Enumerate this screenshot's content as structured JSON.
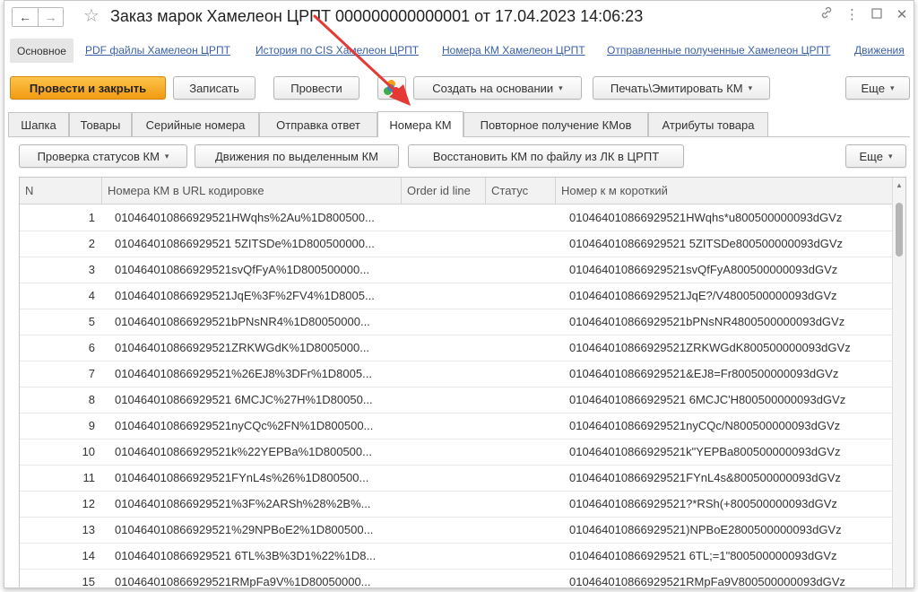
{
  "window": {
    "title": "Заказ марок Хамелеон ЦРПТ 000000000000001 от 17.04.2023 14:06:23",
    "nav_back": "←",
    "nav_forward": "→",
    "star": "☆",
    "icons": [
      "link-icon",
      "more-icon",
      "maximize-icon",
      "close-icon"
    ]
  },
  "links": {
    "main": "Основное",
    "items": [
      "PDF файлы  Хамелеон ЦРПТ",
      "История по CIS Хамелеон ЦРПТ",
      "Номера КМ Хамелеон ЦРПТ",
      "Отправленные полученные Хамелеон ЦРПТ",
      "Движения"
    ]
  },
  "commands": {
    "post_close": "Провести и закрыть",
    "save": "Записать",
    "post": "Провести",
    "create_based": "Создать на основании",
    "print": "Печать\\Эмитировать КМ",
    "more": "Еще"
  },
  "tabs": [
    "Шапка",
    "Товары",
    "Серийные номера",
    "Отправка ответ",
    "Номера КМ",
    "Повторное получение КМов",
    "Атрибуты товара"
  ],
  "active_tab": "Номера КМ",
  "table_commands": {
    "check_status": "Проверка статусов КМ",
    "movements": "Движения по выделенным КМ",
    "restore": "Восстановить КМ по файлу из ЛК в ЦРПТ",
    "more": "Еще"
  },
  "table": {
    "columns": [
      "N",
      "Номера КМ в URL кодировке",
      "Order id line",
      "Статус",
      "Номер к м короткий"
    ],
    "rows": [
      {
        "n": "1",
        "url": "010464010866929521HWqhs%2Au%1D800500...",
        "order": "",
        "status": "",
        "short": "010464010866929521HWqhs*u800500000093dGVz"
      },
      {
        "n": "2",
        "url": "010464010866929521 5ZITSDe%1D800500000...",
        "order": "",
        "status": "",
        "short": "010464010866929521 5ZITSDe800500000093dGVz"
      },
      {
        "n": "3",
        "url": "010464010866929521svQfFyA%1D800500000...",
        "order": "",
        "status": "",
        "short": "010464010866929521svQfFyA800500000093dGVz"
      },
      {
        "n": "4",
        "url": "010464010866929521JqE%3F%2FV4%1D8005...",
        "order": "",
        "status": "",
        "short": "010464010866929521JqE?/V4800500000093dGVz"
      },
      {
        "n": "5",
        "url": "010464010866929521bPNsNR4%1D80050000...",
        "order": "",
        "status": "",
        "short": "010464010866929521bPNsNR4800500000093dGVz"
      },
      {
        "n": "6",
        "url": "010464010866929521ZRKWGdK%1D8005000...",
        "order": "",
        "status": "",
        "short": "010464010866929521ZRKWGdK800500000093dGVz"
      },
      {
        "n": "7",
        "url": "010464010866929521%26EJ8%3DFr%1D8005...",
        "order": "",
        "status": "",
        "short": "010464010866929521&EJ8=Fr800500000093dGVz"
      },
      {
        "n": "8",
        "url": "010464010866929521 6MCJC%27H%1D80050...",
        "order": "",
        "status": "",
        "short": "010464010866929521 6MCJC'H800500000093dGVz"
      },
      {
        "n": "9",
        "url": "010464010866929521nyCQc%2FN%1D800500...",
        "order": "",
        "status": "",
        "short": "010464010866929521nyCQc/N800500000093dGVz"
      },
      {
        "n": "10",
        "url": "010464010866929521k%22YEPBa%1D800500...",
        "order": "",
        "status": "",
        "short": "010464010866929521k\"YEPBa800500000093dGVz"
      },
      {
        "n": "11",
        "url": "010464010866929521FYnL4s%26%1D800500...",
        "order": "",
        "status": "",
        "short": "010464010866929521FYnL4s&800500000093dGVz"
      },
      {
        "n": "12",
        "url": "010464010866929521%3F%2ARSh%28%2B%...",
        "order": "",
        "status": "",
        "short": "010464010866929521?*RSh(+800500000093dGVz"
      },
      {
        "n": "13",
        "url": "010464010866929521%29NPBoE2%1D800500...",
        "order": "",
        "status": "",
        "short": "010464010866929521)NPBoE2800500000093dGVz"
      },
      {
        "n": "14",
        "url": "010464010866929521 6TL%3B%3D1%22%1D8...",
        "order": "",
        "status": "",
        "short": "010464010866929521 6TL;=1\"800500000093dGVz"
      },
      {
        "n": "15",
        "url": "010464010866929521RMpFa9V%1D80050000...",
        "order": "",
        "status": "",
        "short": "010464010866929521RMpFa9V800500000093dGVz"
      }
    ]
  },
  "colors": {
    "primary_button": "#f29b12",
    "link": "#3a5fa8",
    "annotation_arrow": "#e53935"
  }
}
